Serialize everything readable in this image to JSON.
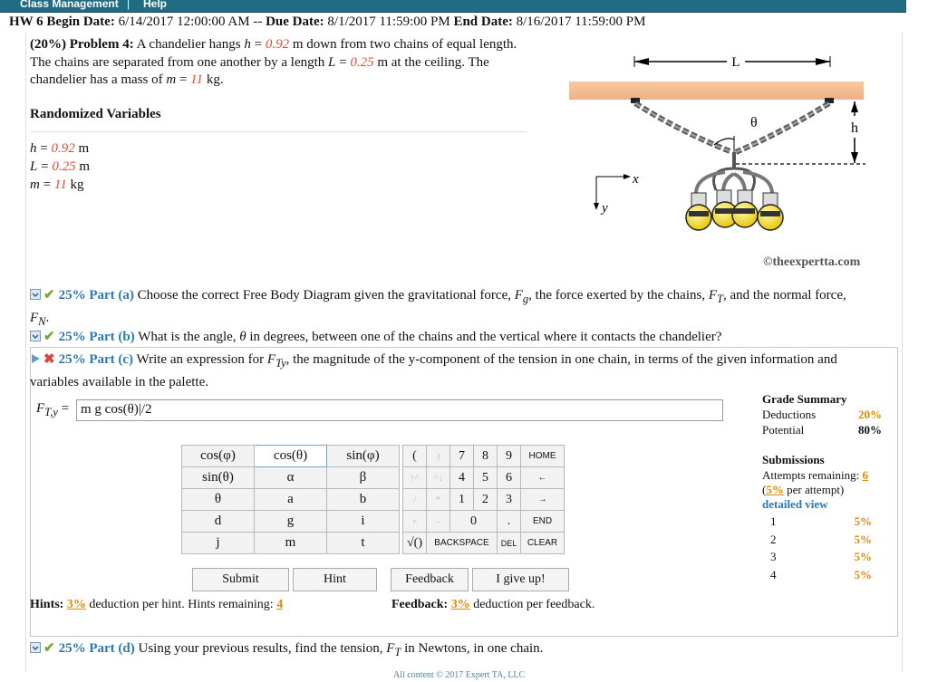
{
  "nav": {
    "class_management": "Class Management",
    "separator": "|",
    "help": "Help"
  },
  "hw": {
    "title": "HW 6",
    "begin_label": "Begin Date:",
    "begin": "6/14/2017 12:00:00 AM",
    "dash": "--",
    "due_label": "Due Date:",
    "due": "8/1/2017 11:59:00 PM",
    "end_label": "End Date:",
    "end": "8/16/2017 11:59:00 PM"
  },
  "problem": {
    "weight": "(20%)",
    "label": "Problem 4:",
    "s1": "A chandelier hangs",
    "h_sym": "h",
    "eq": " = ",
    "h_val": "0.92",
    "s2": "m down from two chains of equal length. The chains are separated from one another by a length",
    "L_sym": "L",
    "L_val": "0.25",
    "s3": "m at the ceiling. The chandelier has a mass of",
    "m_sym": "m",
    "m_val": "11",
    "s4": "kg."
  },
  "randomized": {
    "title": "Randomized Variables",
    "vars": [
      {
        "sym": "h",
        "val": "0.92",
        "unit": "m"
      },
      {
        "sym": "L",
        "val": "0.25",
        "unit": "m"
      },
      {
        "sym": "m",
        "val": "11",
        "unit": "kg"
      }
    ]
  },
  "figure": {
    "L_label": "L",
    "theta_label": "θ",
    "h_label": "h",
    "x_label": "x",
    "y_label": "y",
    "credit": "©theexpertta.com"
  },
  "parts": {
    "a": {
      "pct": "25% Part (a)",
      "text1": "Choose the correct Free Body Diagram given the gravitational force,",
      "fg": "F",
      "fg_sub": "g",
      "text2": ", the force exerted by the chains,",
      "ft": "F",
      "ft_sub": "T",
      "text3": ", and the normal force,",
      "fn": "F",
      "fn_sub": "N",
      "text4": "."
    },
    "b": {
      "pct": "25% Part (b)",
      "text1": "What is the angle,",
      "theta": "θ",
      "text2": "in degrees, between one of the chains and the vertical where it contacts the chandelier?"
    },
    "c": {
      "pct": "25% Part (c)",
      "text1": "Write an expression for",
      "fty": "F",
      "fty_sub": "Ty",
      "text2": ", the magnitude of the y-component of the tension in one chain, in terms of the given information and variables available in the palette."
    },
    "d": {
      "pct": "25% Part (d)",
      "text1": "Using your previous results, find the tension,",
      "ft": "F",
      "ft_sub": "T",
      "text2": "in Newtons, in one chain."
    }
  },
  "answer": {
    "label_F": "F",
    "label_sub": "T,y",
    "label_eq": " =",
    "value": "m g cos(θ)|/2"
  },
  "palette": {
    "row1": [
      "cos(φ)",
      "cos(θ)",
      "sin(φ)",
      "(",
      ")",
      "7",
      "8",
      "9",
      "HOME"
    ],
    "row2": [
      "sin(θ)",
      "α",
      "β",
      "↑^",
      "^↓",
      "4",
      "5",
      "6",
      "←"
    ],
    "row3": [
      "θ",
      "a",
      "b",
      "/",
      "*",
      "1",
      "2",
      "3",
      "→"
    ],
    "row4": [
      "d",
      "g",
      "i",
      "+",
      "-",
      "0",
      ".",
      "END"
    ],
    "row5": [
      "j",
      "m",
      "t",
      "√()",
      "BACKSPACE",
      "DEL",
      "CLEAR"
    ]
  },
  "buttons": {
    "submit": "Submit",
    "hint": "Hint",
    "feedback": "Feedback",
    "give_up": "I give up!"
  },
  "hints": {
    "label": "Hints:",
    "pct": "3%",
    "text": "deduction per hint. Hints remaining:",
    "remaining": "4"
  },
  "feedback": {
    "label": "Feedback:",
    "pct": "3%",
    "text": "deduction per feedback."
  },
  "grade": {
    "title": "Grade Summary",
    "deductions_label": "Deductions",
    "deductions": "20%",
    "potential_label": "Potential",
    "potential": "80%"
  },
  "submissions": {
    "title": "Submissions",
    "remaining_label": "Attempts remaining:",
    "remaining": "6",
    "per_attempt_pct": "5%",
    "per_attempt_text": "per attempt)",
    "detailed": "detailed view",
    "attempts": [
      {
        "n": "1",
        "pct": "5%"
      },
      {
        "n": "2",
        "pct": "5%"
      },
      {
        "n": "3",
        "pct": "5%"
      },
      {
        "n": "4",
        "pct": "5%"
      }
    ]
  },
  "footer": "All content © 2017 Expert TA, LLC",
  "colors": {
    "accent_blue": "#2b78b8",
    "random_red": "#e0503a",
    "orange": "#e08a00",
    "check_green": "#7aa834",
    "cross_red": "#d9463b",
    "nav_bar": "#1f6c84"
  }
}
